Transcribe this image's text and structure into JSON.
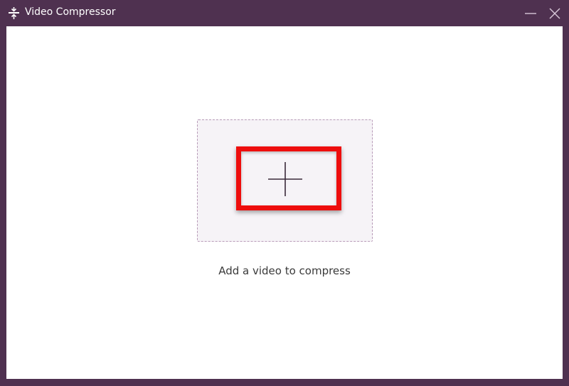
{
  "window": {
    "title": "Video Compressor",
    "app_icon": "compress-icon",
    "minimize_icon": "minimize-icon",
    "close_icon": "close-icon"
  },
  "drop_zone": {
    "add_icon": "plus-icon",
    "caption": "Add a video to compress"
  },
  "colors": {
    "titlebar": "#4f3150",
    "drop_zone_bg": "#f6f3f7",
    "drop_zone_border": "#b79ab7",
    "highlight": "#ee0d0d"
  }
}
